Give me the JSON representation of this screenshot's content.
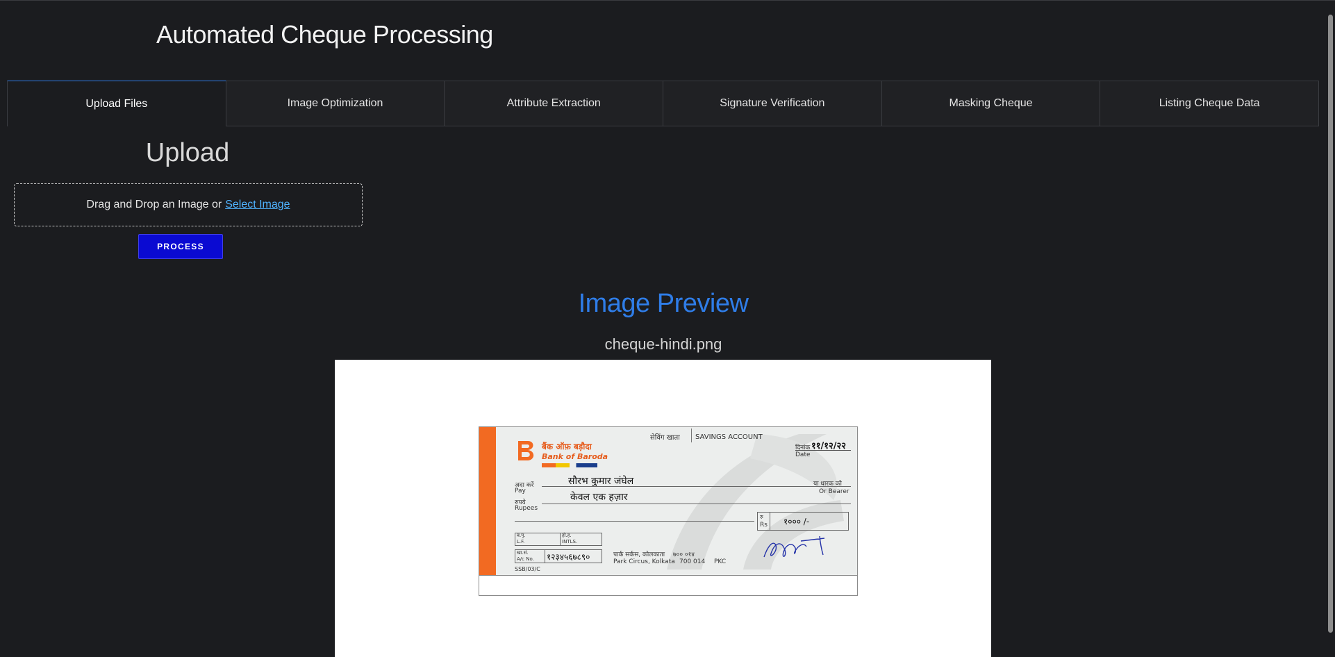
{
  "app": {
    "title": "Automated Cheque Processing"
  },
  "tabs": [
    {
      "label": "Upload Files",
      "active": true
    },
    {
      "label": "Image Optimization",
      "active": false
    },
    {
      "label": "Attribute Extraction",
      "active": false
    },
    {
      "label": "Signature Verification",
      "active": false
    },
    {
      "label": "Masking Cheque",
      "active": false
    },
    {
      "label": "Listing Cheque Data",
      "active": false
    }
  ],
  "upload": {
    "heading": "Upload",
    "dropzone_text": "Drag and Drop an Image or",
    "select_link": "Select Image",
    "process_button": "PROCESS"
  },
  "preview": {
    "heading": "Image Preview",
    "filename": "cheque-hindi.png"
  },
  "cheque": {
    "bank_hindi": "बैंक ऑफ़ बड़ौदा",
    "bank_english": "Bank of Baroda",
    "account_type_hindi": "सेविंग खाता",
    "account_type": "SAVINGS ACCOUNT",
    "date_label_hindi": "दिनांक",
    "date_label": "Date",
    "date_value": "११/१२/२२",
    "pay_label_hindi": "अदा करें",
    "pay_label": "Pay",
    "payee": "सौरभ कुमार जंघेल",
    "bearer_hindi": "या धारक को",
    "bearer": "Or Bearer",
    "rupees_label_hindi": "रुपये",
    "rupees_label": "Rupees",
    "amount_words": "केवल एक हज़ार",
    "rs_label_hindi": "रु",
    "rs_label": "Rs",
    "amount_figure": "१००० /-",
    "lf_label_hindi": "ब.पृ.",
    "lf_label": "L.F.",
    "intls_label_hindi": "हो.ह.",
    "intls_label": "INTLS.",
    "acno_label_hindi": "खा.सं.",
    "acno_label": "A/c No.",
    "account_number": "१२३४५६७८९०",
    "branch_hindi": "पार्क सर्कस, कोलकाता",
    "pin_hindi": "७०० ०१४",
    "branch": "Park Circus, Kolkata",
    "pin": "700 014",
    "branch_code": "PKC",
    "form_code": "SSB/03/C"
  },
  "colors": {
    "background": "#1b1c1f",
    "accent": "#2f7de8",
    "button": "#0a0ad2",
    "link": "#4fb3ff",
    "cheque_stripe": "#f26a22"
  }
}
